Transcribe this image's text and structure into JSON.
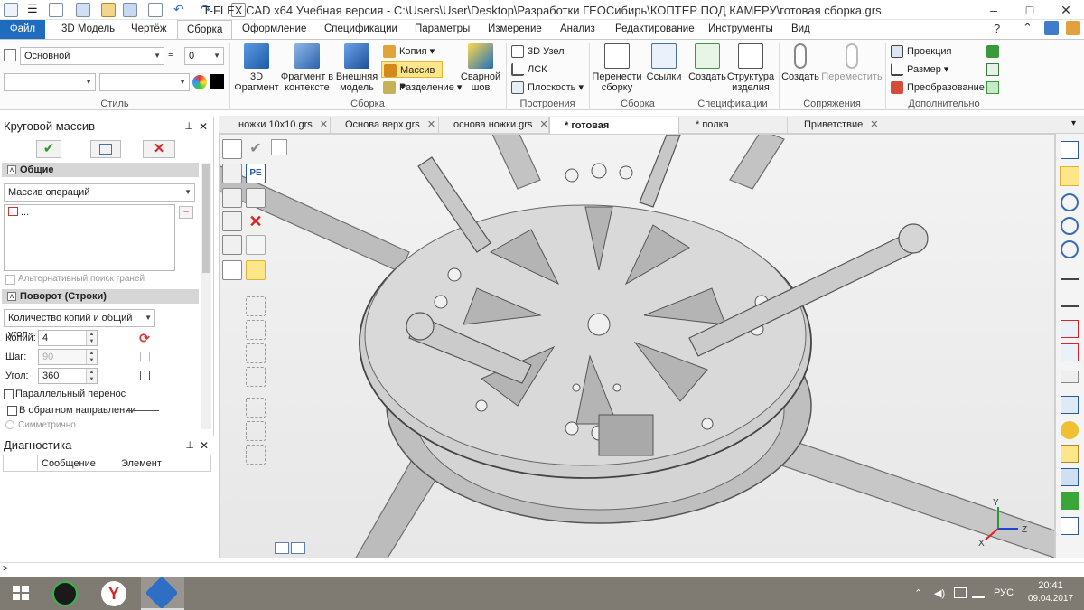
{
  "window": {
    "title": "T-FLEX CAD x64 Учебная версия - C:\\Users\\User\\Desktop\\Разработки ГЕОСибирь\\КОПТЕР ПОД КАМЕРУ\\готовая сборка.grs",
    "minimize": "–",
    "maximize": "□",
    "close": "✕"
  },
  "menu_tabs": [
    {
      "label": "Файл"
    },
    {
      "label": "3D Модель"
    },
    {
      "label": "Чертёж"
    },
    {
      "label": "Сборка"
    },
    {
      "label": "Оформление"
    },
    {
      "label": "Спецификации"
    },
    {
      "label": "Параметры"
    },
    {
      "label": "Измерение"
    },
    {
      "label": "Анализ"
    },
    {
      "label": "Редактирование"
    },
    {
      "label": "Инструменты"
    },
    {
      "label": "Вид"
    }
  ],
  "active_tab": "Сборка",
  "ribbon": {
    "style": {
      "layer": "Основной",
      "number": "0",
      "label": "Стиль"
    },
    "assembly": {
      "fragment3d": "3D\nФрагмент",
      "fragment_context": "Фрагмент в\nконтексте",
      "external_model": "Внешняя\nмодель",
      "copy": "Копия",
      "array": "Массив",
      "split": "Разделение",
      "weld": "Сварной\nшов",
      "label": "Сборка"
    },
    "build": {
      "node3d": "3D Узел",
      "lsk": "ЛСК",
      "plane": "Плоскость",
      "label": "Построения"
    },
    "assembly2": {
      "move": "Перенести\nсборку",
      "links": "Ссылки",
      "label": "Сборка"
    },
    "spec": {
      "create": "Создать",
      "structure": "Структура\nизделия",
      "label": "Спецификации"
    },
    "mates": {
      "create": "Создать",
      "move": "Переместить",
      "label": "Сопряжения"
    },
    "extra": {
      "projection": "Проекция",
      "size": "Размер",
      "transform": "Преобразование",
      "label": "Дополнительно"
    }
  },
  "left_panel": {
    "title": "Круговой массив",
    "section_general": "Общие",
    "array_type": "Массив операций",
    "list_item": "...",
    "alt_search": "Альтернативный поиск граней",
    "section_rotation": "Поворот (Строки)",
    "rotation_mode": "Количество копий и общий угол",
    "copies_label": "Копий:",
    "copies_value": "4",
    "step_label": "Шаг:",
    "step_value": "90",
    "angle_label": "Угол:",
    "angle_value": "360",
    "parallel": "Параллельный перенос",
    "reverse": "В обратном направлении",
    "symmetric": "Симметрично"
  },
  "diagnostics": {
    "title": "Диагностика",
    "columns": [
      "Сообщение",
      "Элемент"
    ]
  },
  "doc_tabs": [
    {
      "label": "ножки 10x10.grs"
    },
    {
      "label": "Основа верх.grs"
    },
    {
      "label": "основа ножки.grs"
    },
    {
      "label": "* готовая сборка.grs"
    },
    {
      "label": "* полка ножки.grs"
    },
    {
      "label": "Приветствие"
    }
  ],
  "active_doc": "* готовая сборка.grs",
  "axes": {
    "x": "X",
    "y": "Y",
    "z": "Z"
  },
  "status_text": ">",
  "taskbar": {
    "lang": "РУС",
    "time": "20:41",
    "date": "09.04.2017"
  }
}
